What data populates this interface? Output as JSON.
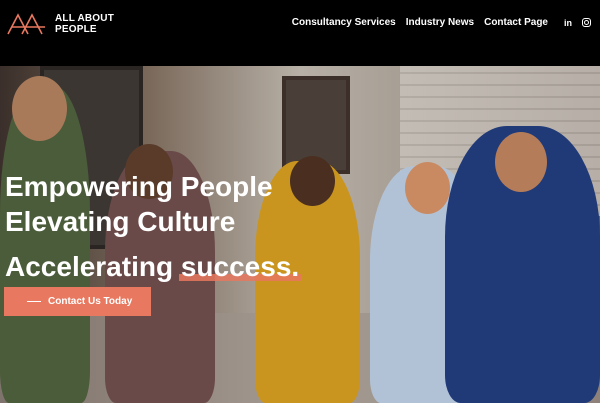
{
  "brand": {
    "name_line1": "ALL ABOUT",
    "name_line2": "PEOPLE",
    "accent_color": "#e8785f"
  },
  "nav": {
    "items": [
      {
        "label": "Consultancy Services"
      },
      {
        "label": "Industry News"
      },
      {
        "label": "Contact Page"
      }
    ],
    "social": [
      {
        "icon": "linkedin-icon",
        "text": "in"
      },
      {
        "icon": "instagram-icon",
        "text": ""
      }
    ]
  },
  "hero": {
    "line1": "Empowering People",
    "line2": "Elevating Culture",
    "line3_prefix": "Accelerating ",
    "line3_accent": "success.",
    "cta_label": "Contact Us Today"
  }
}
